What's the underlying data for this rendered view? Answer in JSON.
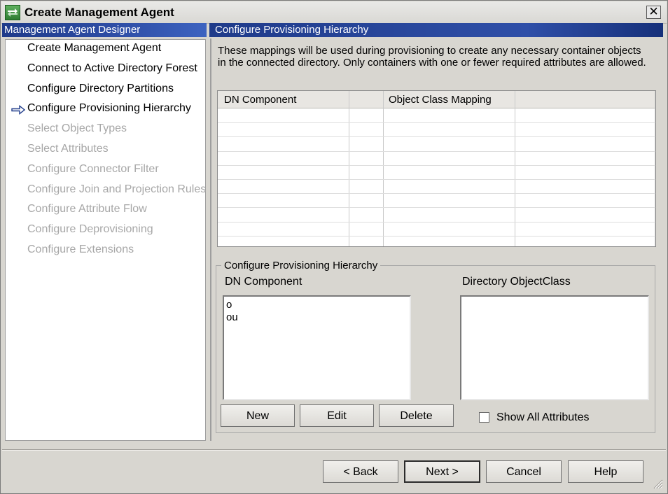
{
  "window": {
    "title": "Create Management Agent",
    "close_glyph": "✕"
  },
  "nav": {
    "header": "Management Agent Designer",
    "items": [
      {
        "label": "Create Management Agent",
        "state": "completed"
      },
      {
        "label": "Connect to Active Directory Forest",
        "state": "completed"
      },
      {
        "label": "Configure Directory Partitions",
        "state": "completed"
      },
      {
        "label": "Configure Provisioning Hierarchy",
        "state": "current"
      },
      {
        "label": "Select Object Types",
        "state": "disabled"
      },
      {
        "label": "Select Attributes",
        "state": "disabled"
      },
      {
        "label": "Configure Connector Filter",
        "state": "disabled"
      },
      {
        "label": "Configure Join and Projection Rules",
        "state": "disabled"
      },
      {
        "label": "Configure Attribute Flow",
        "state": "disabled"
      },
      {
        "label": "Configure Deprovisioning",
        "state": "disabled"
      },
      {
        "label": "Configure Extensions",
        "state": "disabled"
      }
    ],
    "current_icon": "right-arrow-icon"
  },
  "main": {
    "header": "Configure Provisioning Hierarchy",
    "description": "These mappings will be used during provisioning to create any necessary container objects in the connected directory.  Only containers with one or fewer required attributes are allowed.",
    "grid": {
      "columns": [
        "DN Component",
        "",
        "Object Class Mapping",
        ""
      ]
    },
    "group": {
      "legend": "Configure Provisioning Hierarchy",
      "dn_label": "DN Component",
      "objectclass_label": "Directory ObjectClass",
      "dn_items": [
        "o",
        "ou"
      ],
      "objectclass_items": [],
      "new_button": "New",
      "edit_button": "Edit",
      "delete_button": "Delete",
      "show_all_label": "Show All Attributes",
      "show_all_checked": false
    }
  },
  "footer": {
    "back_button": "<  Back",
    "next_button": "Next  >",
    "cancel_button": "Cancel",
    "help_button": "Help"
  },
  "colors": {
    "header_blue": "#2f4fa8",
    "window_bg": "#d8d6d0",
    "disabled_text": "#a7a7a7"
  }
}
